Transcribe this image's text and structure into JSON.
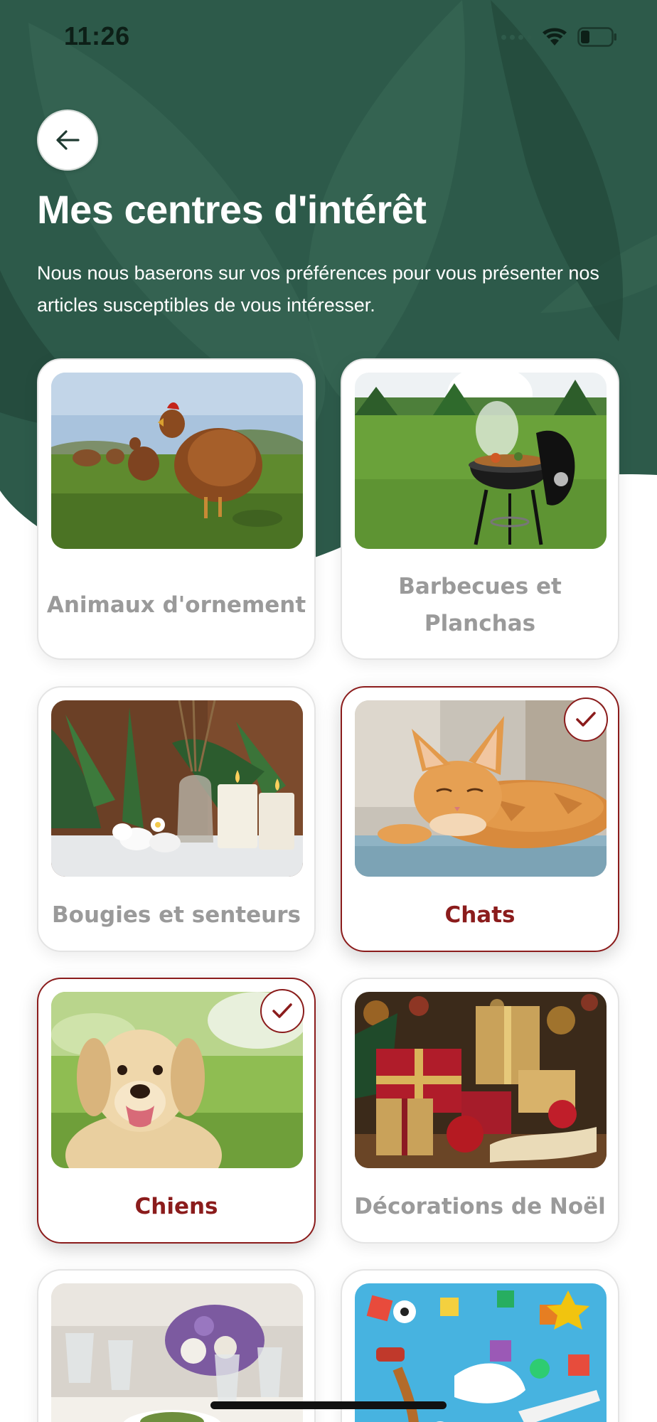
{
  "status_bar": {
    "time": "11:26"
  },
  "colors": {
    "header_green": "#2d5a4a",
    "header_green_dark": "#264d3f",
    "selected_accent": "#8b1c1c",
    "label_gray": "#9a9a9a",
    "card_border": "#e4e4e4"
  },
  "header": {
    "back_icon": "arrow-left-icon",
    "title": "Mes centres d'intérêt",
    "subtitle": "Nous nous baserons sur vos préférences pour vous présenter nos articles susceptibles de vous intéresser."
  },
  "interests": [
    {
      "label": "Animaux d'ornement",
      "image": "chickens-photo",
      "selected": false
    },
    {
      "label": "Barbecues et Planchas",
      "image": "barbecue-photo",
      "selected": false
    },
    {
      "label": "Bougies et senteurs",
      "image": "candles-photo",
      "selected": false
    },
    {
      "label": "Chats",
      "image": "cat-photo",
      "selected": true
    },
    {
      "label": "Chiens",
      "image": "dog-photo",
      "selected": true
    },
    {
      "label": "Décorations de Noël",
      "image": "christmas-gifts-photo",
      "selected": false
    },
    {
      "label": "",
      "image": "table-setting-photo",
      "selected": false
    },
    {
      "label": "",
      "image": "toys-photo",
      "selected": false
    }
  ],
  "icons": {
    "check": "checkmark-icon",
    "wifi": "wifi-icon",
    "battery": "battery-icon",
    "signal": "signal-icon"
  }
}
